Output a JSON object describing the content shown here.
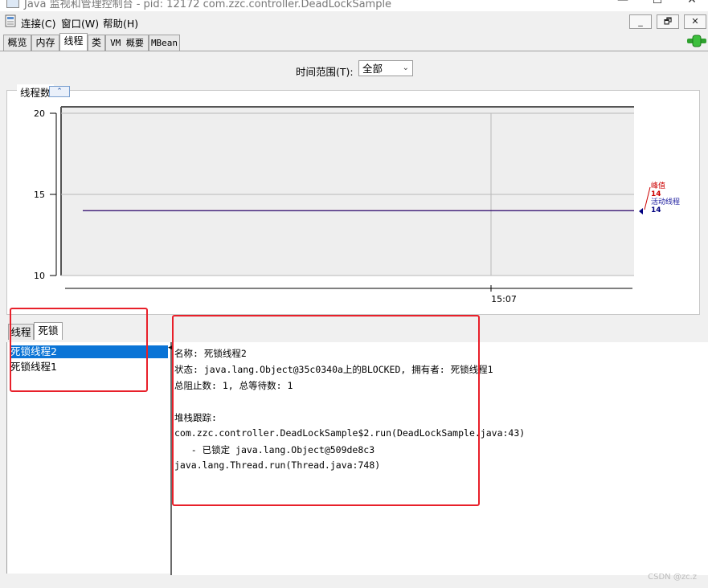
{
  "window": {
    "title": "Java 监视和管理控制台 - pid: 12172 com.zzc.controller.DeadLockSample",
    "minimize": "—",
    "maximize": "☐",
    "close": "✕"
  },
  "menu": {
    "items": [
      "连接(C)",
      "窗口(W)",
      "帮助(H)"
    ],
    "inner_buttons": [
      "_",
      "🗗",
      "✕"
    ]
  },
  "tabs": [
    "概览",
    "内存",
    "线程",
    "类",
    "VM 概要",
    "MBean"
  ],
  "time_range": {
    "label": "时间范围(T):",
    "value": "全部"
  },
  "chart": {
    "title": "线程数",
    "collapse_icon": "chevron-up-double-icon",
    "legend_peak_label": "峰值",
    "legend_peak_value": "14",
    "legend_live_label": "活动线程",
    "legend_live_value": "14",
    "colors": {
      "peak": "#cc0000",
      "live": "#000080"
    }
  },
  "chart_data": {
    "type": "line",
    "yticks": [
      "20",
      "15",
      "10"
    ],
    "ylim": [
      10,
      20
    ],
    "xtick": "15:07",
    "series": [
      {
        "name": "峰值",
        "values": [
          14,
          14
        ]
      },
      {
        "name": "活动线程",
        "values": [
          14,
          14
        ]
      }
    ]
  },
  "subtabs": [
    "线程",
    "死锁"
  ],
  "threads": [
    "死锁线程2",
    "死锁线程1"
  ],
  "detail": {
    "name_line": "名称: 死锁线程2",
    "state_line": "状态: java.lang.Object@35c0340a上的BLOCKED, 拥有者: 死锁线程1",
    "counts_line": "总阻止数: 1, 总等待数: 1",
    "stack_header": "堆栈跟踪:",
    "stack": [
      "com.zzc.controller.DeadLockSample$2.run(DeadLockSample.java:43)",
      "   - 已锁定 java.lang.Object@509de8c3",
      "java.lang.Thread.run(Thread.java:748)"
    ]
  },
  "watermark": "CSDN @zc.z"
}
